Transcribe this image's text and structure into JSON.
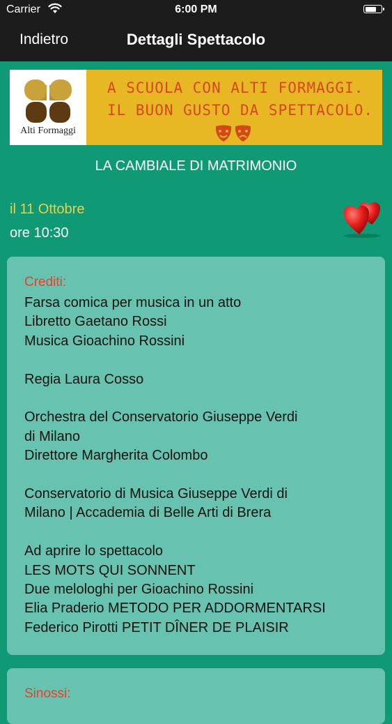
{
  "status_bar": {
    "carrier": "Carrier",
    "time": "6:00 PM"
  },
  "nav": {
    "back_label": "Indietro",
    "title": "Dettagli Spettacolo"
  },
  "banner": {
    "brand": "Alti Formaggi",
    "line1": "A SCUOLA CON ALTI FORMAGGI.",
    "line2": "IL BUON GUSTO DA SPETTACOLO."
  },
  "show": {
    "title": "LA CAMBIALE DI MATRIMONIO",
    "date": "il 11 Ottobre",
    "time": "ore 10:30"
  },
  "credits": {
    "heading": "Crediti:",
    "lines": [
      "Farsa comica per musica in un atto",
      "Libretto Gaetano Rossi",
      "Musica Gioachino Rossini",
      "",
      "Regia Laura Cosso",
      "",
      "Orchestra del Conservatorio Giuseppe Verdi",
      "di Milano",
      "Direttore Margherita Colombo",
      "",
      "Conservatorio di Musica Giuseppe Verdi di",
      "Milano | Accademia di Belle Arti di Brera",
      "",
      "Ad aprire lo spettacolo",
      "LES MOTS QUI SONNENT",
      "Due melologhi per Gioachino Rossini",
      "Elia Praderio METODO PER ADDORMENTARSI",
      "Federico Pirotti PETIT DÎNER DE PLAISIR"
    ]
  },
  "synopsis": {
    "heading": "Sinossi:"
  },
  "colors": {
    "background": "#0f9a75",
    "card": "#67c3b0",
    "date": "#e7d04a",
    "heading": "#e2432f",
    "banner": "#e8b824"
  }
}
